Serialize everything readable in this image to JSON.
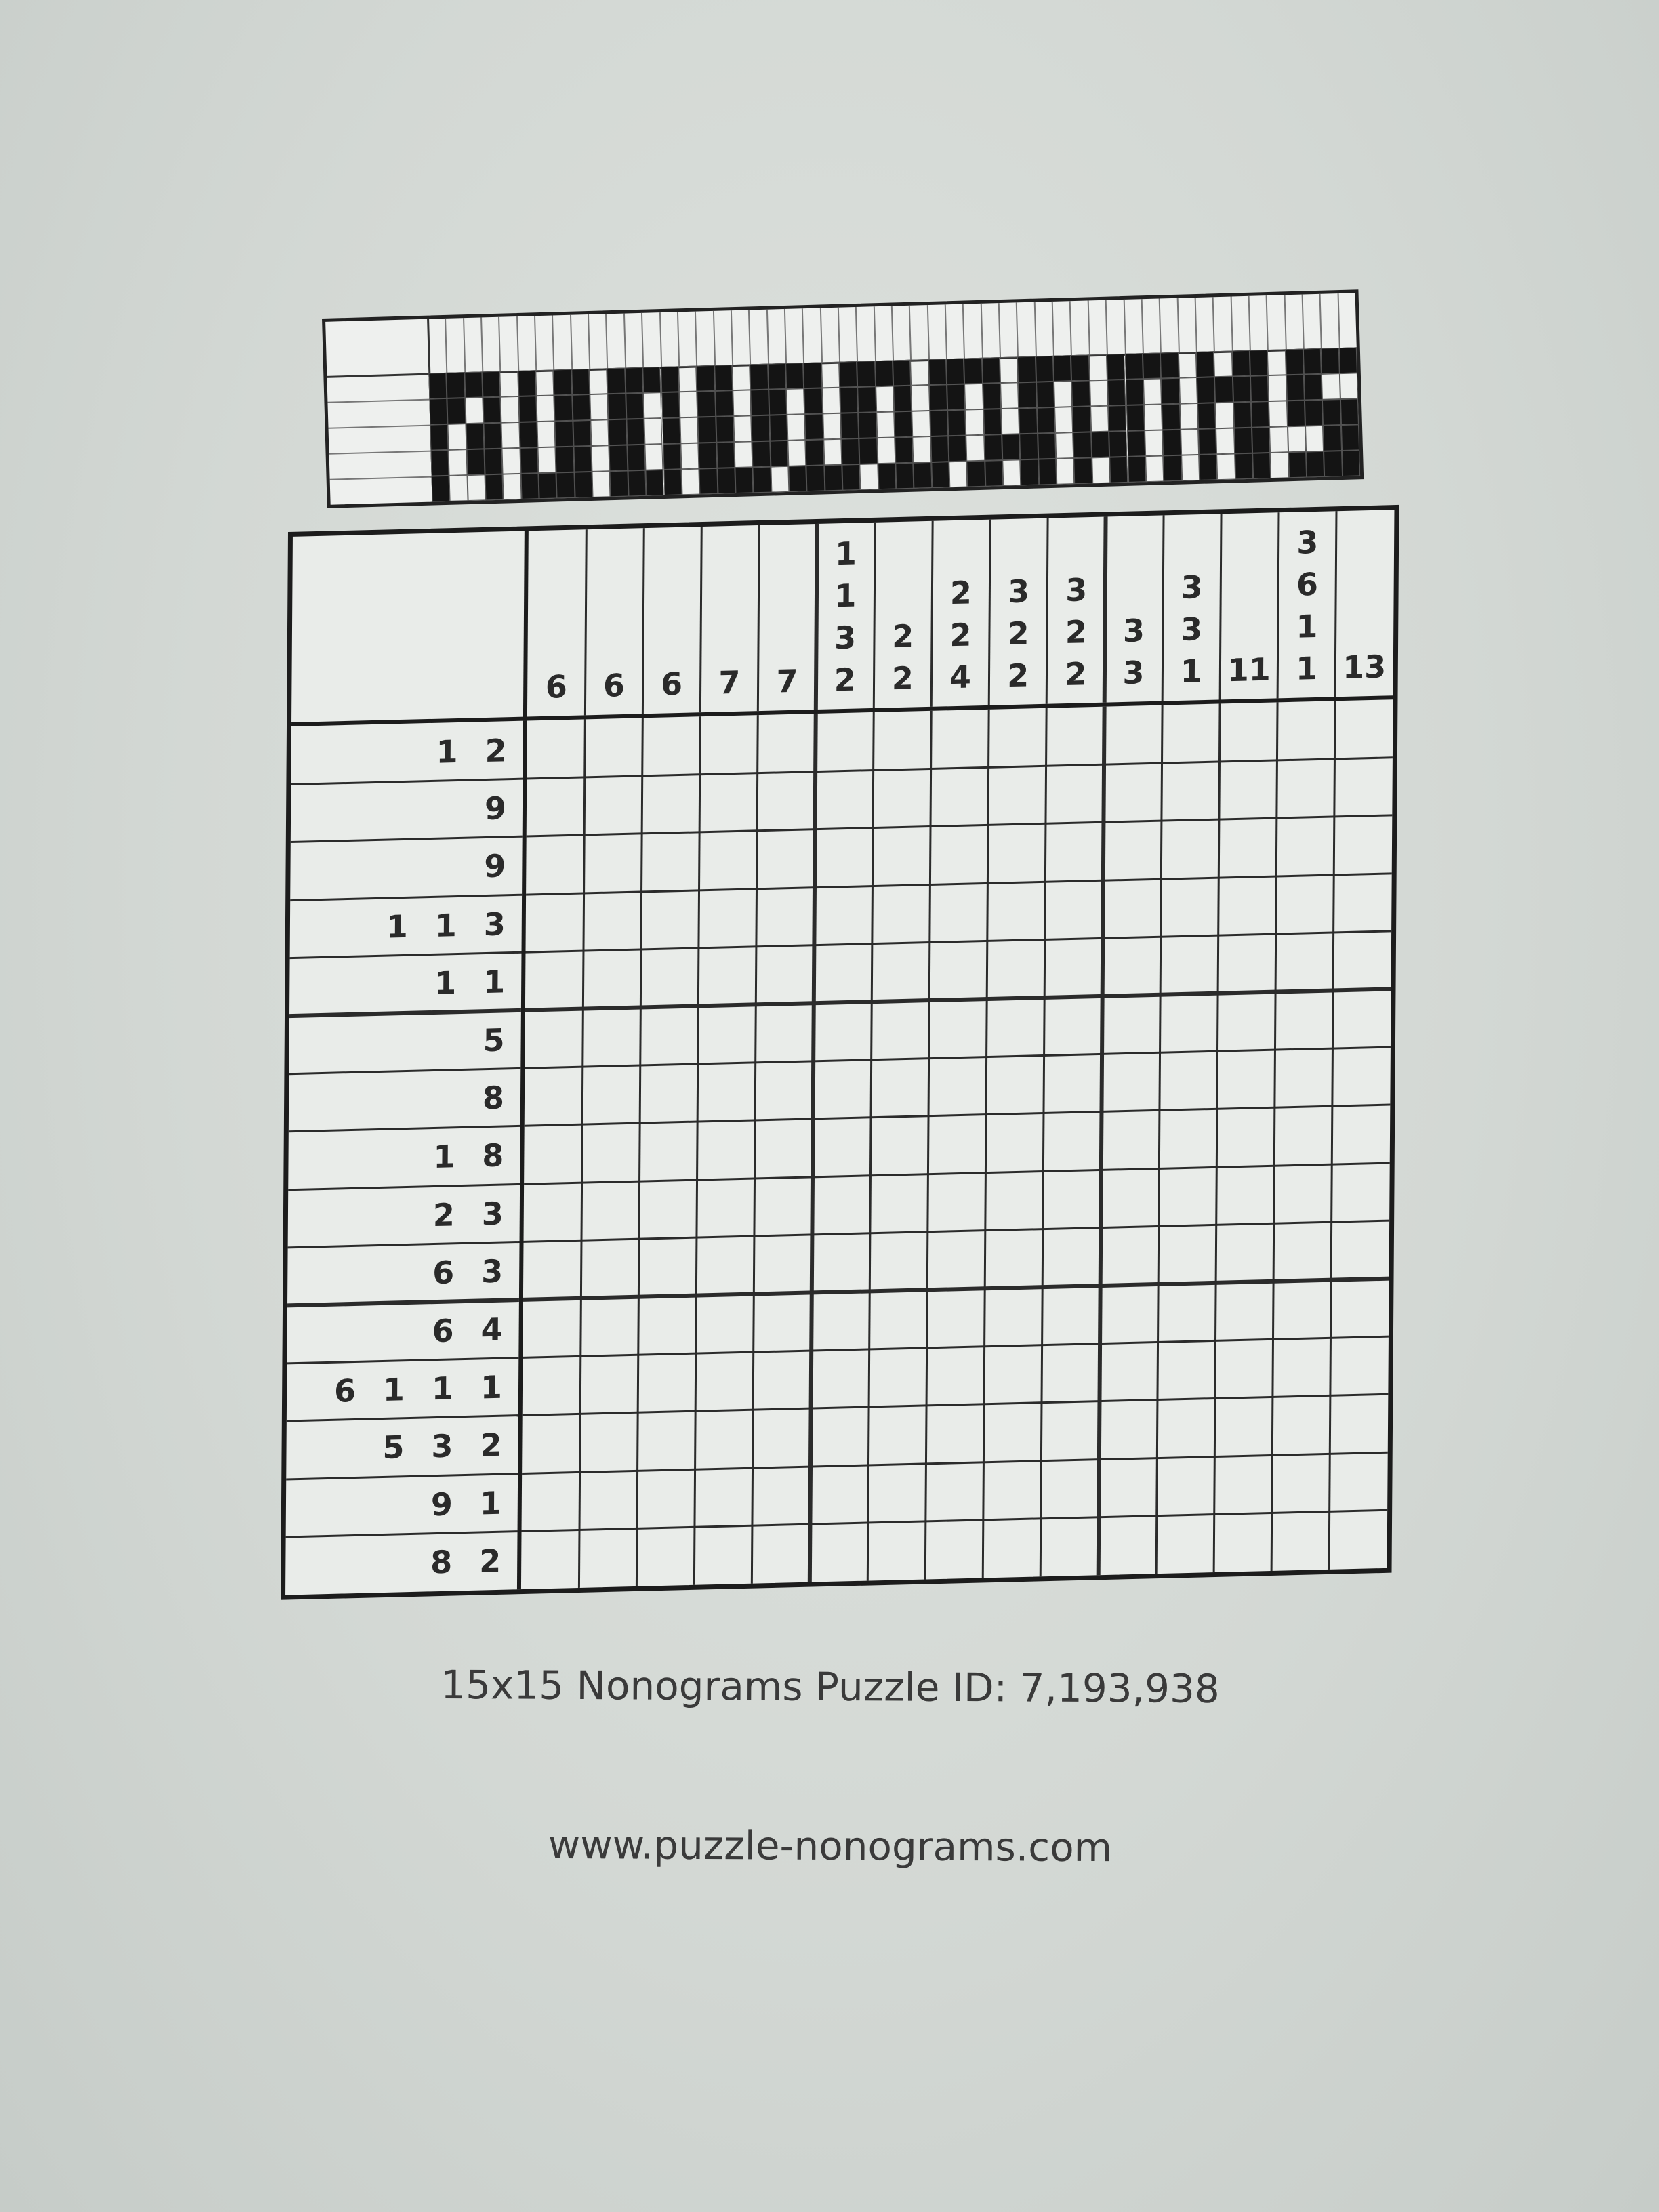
{
  "banner": {
    "pattern": [
      "1111010110111101101111011110111101111011110101101111",
      "1101010110110101101101011010110101101011010111101100",
      "1011010110110101101101011010110101101011010101101111",
      "1011010110110101101101011010110111101111010101100011",
      "1001011110111101111011110111101101101011010101101111"
    ]
  },
  "puzzle": {
    "size": 15,
    "column_clues": [
      [
        "6"
      ],
      [
        "6"
      ],
      [
        "6"
      ],
      [
        "7"
      ],
      [
        "7"
      ],
      [
        "1",
        "1",
        "3",
        "2"
      ],
      [
        "2",
        "2"
      ],
      [
        "2",
        "2",
        "4"
      ],
      [
        "3",
        "2",
        "2"
      ],
      [
        "3",
        "2",
        "2"
      ],
      [
        "3",
        "3"
      ],
      [
        "3",
        "3",
        "1"
      ],
      [
        "11"
      ],
      [
        "3",
        "6",
        "1",
        "1"
      ],
      [
        "13"
      ]
    ],
    "row_clues": [
      [
        "1",
        "2"
      ],
      [
        "9"
      ],
      [
        "9"
      ],
      [
        "1",
        "1",
        "3"
      ],
      [
        "1",
        "1"
      ],
      [
        "5"
      ],
      [
        "8"
      ],
      [
        "1",
        "8"
      ],
      [
        "2",
        "3"
      ],
      [
        "6",
        "3"
      ],
      [
        "6",
        "4"
      ],
      [
        "6",
        "1",
        "1",
        "1"
      ],
      [
        "5",
        "3",
        "2"
      ],
      [
        "9",
        "1"
      ],
      [
        "8",
        "2"
      ]
    ]
  },
  "footer": {
    "puzzle_id_text": "15x15 Nonograms Puzzle ID: 7,193,938",
    "url_text": "www.puzzle-nonograms.com"
  }
}
